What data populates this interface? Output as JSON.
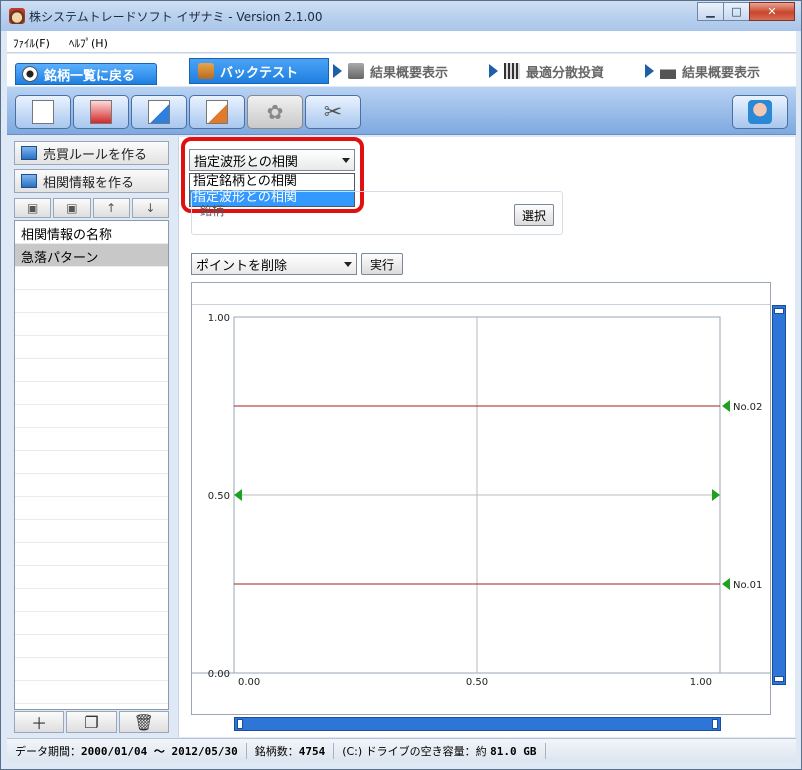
{
  "window": {
    "title": "株システムトレードソフト イザナミ - Version 2.1.00",
    "minimize": "▁",
    "maximize": "□",
    "close": "✕"
  },
  "menu": {
    "file": "ﾌｧｲﾙ(F)",
    "help": "ﾍﾙﾌﾟ(H)"
  },
  "tabs": {
    "back": "銘柄一覧に戻る",
    "backtest": "バックテスト",
    "summary1": "結果概要表示",
    "optimal": "最適分散投資",
    "summary2": "結果概要表示"
  },
  "left": {
    "rule_button": "売買ルールを作る",
    "corr_button": "相関情報を作る",
    "list_header": "相関情報の名称",
    "list_items": [
      "急落パターン"
    ]
  },
  "main": {
    "combo_value": "指定波形との相関",
    "dropdown_options": [
      "指定銘柄との相関",
      "指定波形との相関"
    ],
    "group_label": "銘柄",
    "select_button": "選択",
    "point_combo": "ポイントを削除",
    "exec_button": "実行"
  },
  "chart": {
    "y_ticks": [
      "1.00",
      "0.50",
      "0.00"
    ],
    "x_ticks": [
      "0.00",
      "0.50",
      "1.00"
    ],
    "markers": [
      "No.02",
      "No.01"
    ]
  },
  "chart_data": {
    "type": "line",
    "xlim": [
      0,
      1
    ],
    "ylim": [
      0,
      1
    ],
    "series": [
      {
        "name": "No.02",
        "x": [
          0,
          1
        ],
        "y": [
          0.75,
          0.75
        ]
      },
      {
        "name": "No.01",
        "x": [
          0,
          1
        ],
        "y": [
          0.25,
          0.25
        ]
      }
    ],
    "control_points": [
      {
        "x": 0,
        "y": 0.5
      },
      {
        "x": 1,
        "y": 0.5
      }
    ]
  },
  "status": {
    "period_label": "データ期間：",
    "period_value": "2000/01/04 〜 2012/05/30",
    "count_label": "銘柄数：",
    "count_value": "4754",
    "disk_label": "(C:) ドライブの空き容量：約 ",
    "disk_value": "81.0 GB"
  },
  "colors": {
    "accent": "#1f7fe0",
    "highlight": "#e01010",
    "series_line": "#a02020",
    "marker": "#20a020"
  }
}
